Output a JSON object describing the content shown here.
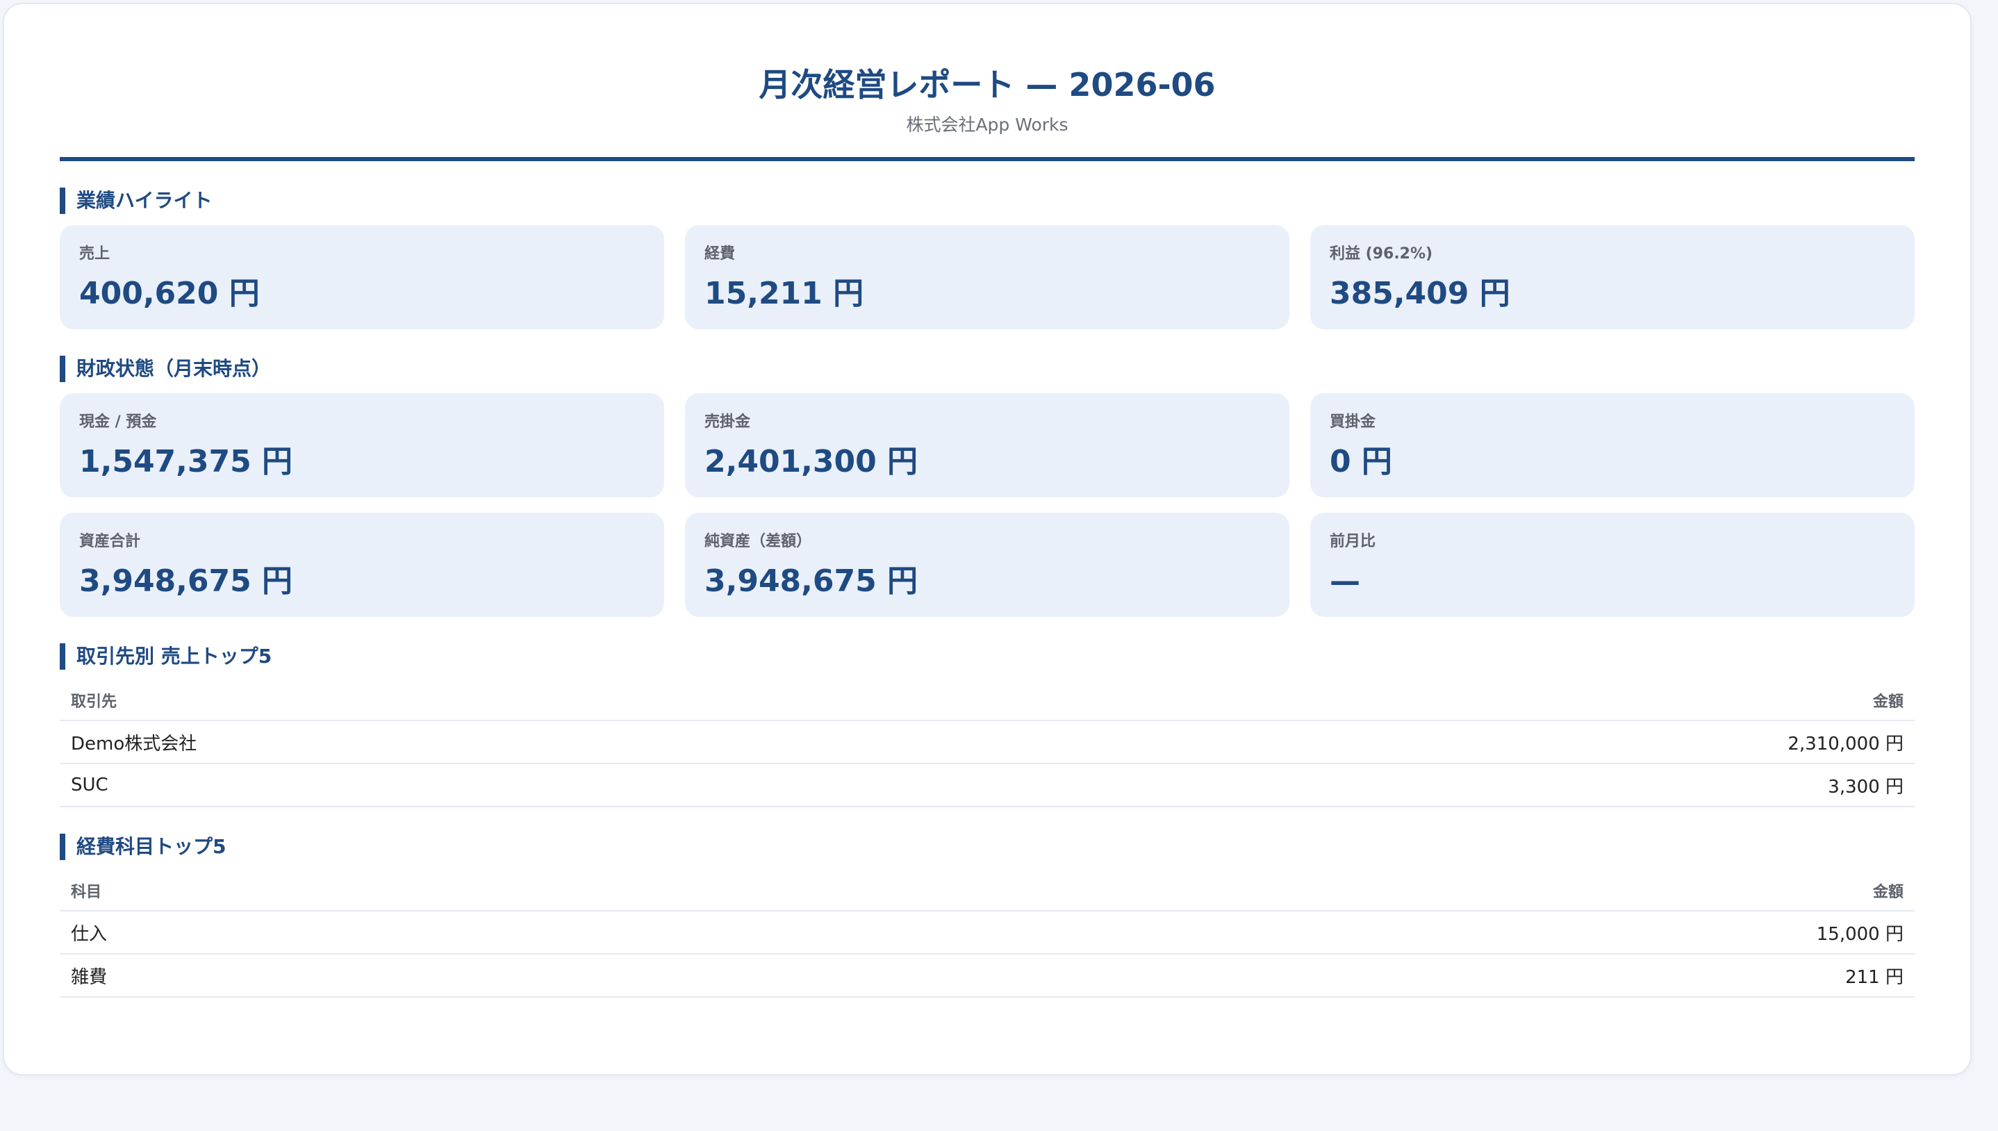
{
  "header": {
    "title": "月次経営レポート — 2026-06",
    "subtitle": "株式会社App Works"
  },
  "highlights": {
    "title": "業績ハイライト",
    "cards": [
      {
        "label": "売上",
        "value": "400,620 円"
      },
      {
        "label": "経費",
        "value": "15,211 円"
      },
      {
        "label": "利益 (96.2%)",
        "value": "385,409 円"
      }
    ]
  },
  "financial": {
    "title": "財政状態（月末時点）",
    "cards": [
      {
        "label": "現金 / 預金",
        "value": "1,547,375 円"
      },
      {
        "label": "売掛金",
        "value": "2,401,300 円"
      },
      {
        "label": "買掛金",
        "value": "0 円"
      },
      {
        "label": "資産合計",
        "value": "3,948,675 円"
      },
      {
        "label": "純資産（差額）",
        "value": "3,948,675 円"
      },
      {
        "label": "前月比",
        "value": "—"
      }
    ]
  },
  "sales_top": {
    "title": "取引先別 売上トップ5",
    "headers": [
      "取引先",
      "金額"
    ],
    "rows": [
      {
        "name": "Demo株式会社",
        "amount": "2,310,000 円"
      },
      {
        "name": "SUC",
        "amount": "3,300 円"
      }
    ]
  },
  "expense_top": {
    "title": "経費科目トップ5",
    "headers": [
      "科目",
      "金額"
    ],
    "rows": [
      {
        "name": "仕入",
        "amount": "15,000 円"
      },
      {
        "name": "雑費",
        "amount": "211 円"
      }
    ]
  }
}
